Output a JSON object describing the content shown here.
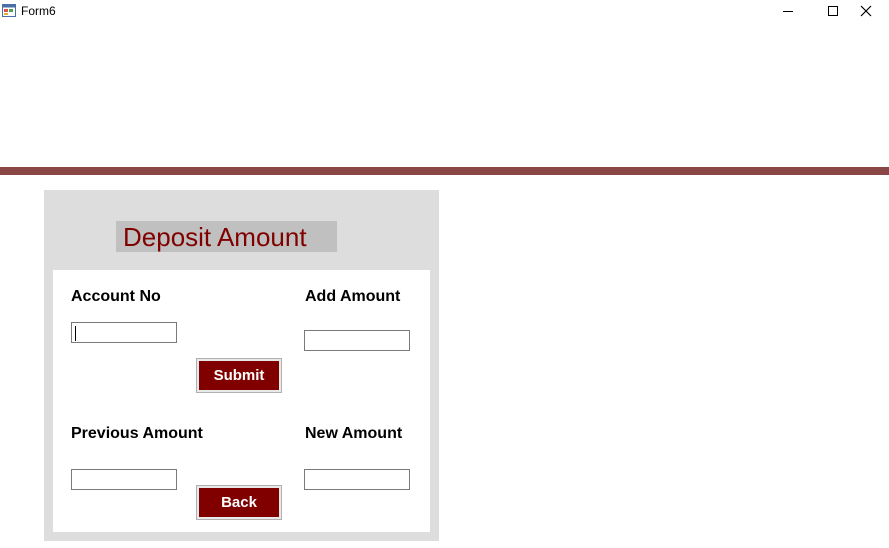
{
  "window": {
    "title": "Form6",
    "controls": [
      "minimize-icon",
      "maximize-icon",
      "close-icon"
    ]
  },
  "form": {
    "heading": "Deposit Amount",
    "account_no_label": "Account No",
    "account_no_value": "",
    "add_amount_label": "Add Amount",
    "add_amount_value": "",
    "submit_label": "Submit",
    "previous_amount_label": "Previous Amount",
    "previous_amount_value": "",
    "new_amount_label": "New Amount",
    "new_amount_value": "",
    "back_label": "Back"
  },
  "colors": {
    "accent_bar": "#8a4745",
    "button_bg": "#800000",
    "heading_color": "#800000",
    "panel_bg": "#dddddd"
  }
}
